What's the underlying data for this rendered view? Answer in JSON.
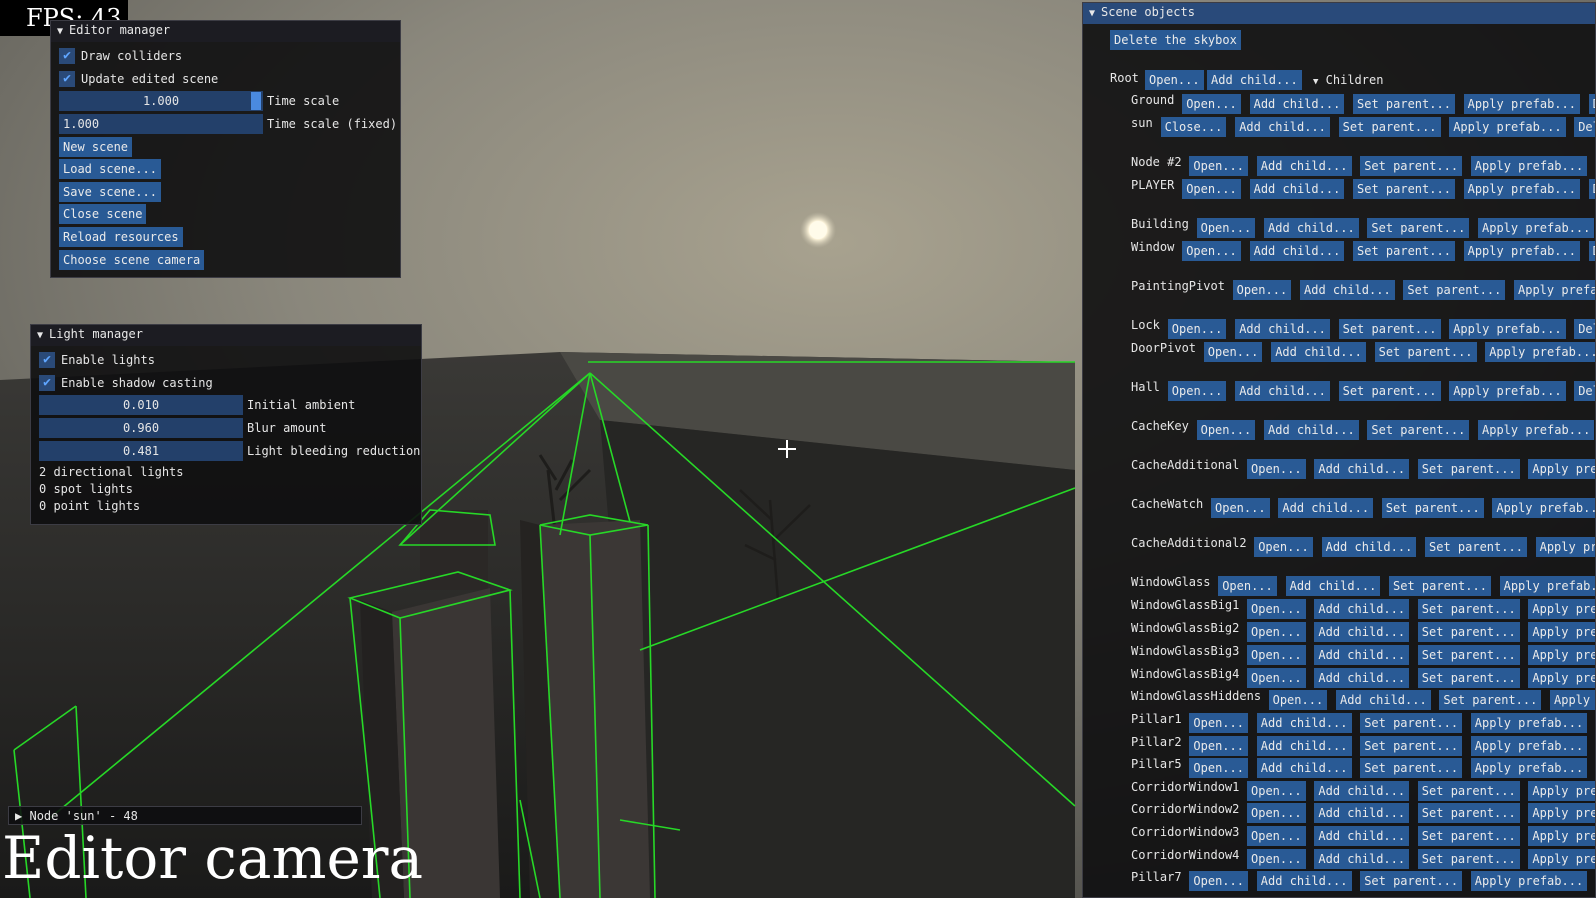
{
  "fps": "FPS: 43",
  "editor_manager": {
    "title": "Editor manager",
    "draw_colliders": "Draw colliders",
    "update_edited_scene": "Update edited scene",
    "time_scale_value": "1.000",
    "time_scale_label": "Time scale",
    "time_scale_fixed_value": "1.000",
    "time_scale_fixed_label": "Time scale (fixed)",
    "buttons": [
      "New scene",
      "Load scene...",
      "Save scene...",
      "Close scene",
      "Reload resources",
      "Choose scene camera"
    ]
  },
  "light_manager": {
    "title": "Light manager",
    "enable_lights": "Enable lights",
    "enable_shadow_casting": "Enable shadow casting",
    "initial_ambient_value": "0.010",
    "initial_ambient_label": "Initial ambient",
    "blur_amount_value": "0.960",
    "blur_amount_label": "Blur amount",
    "light_bleeding_value": "0.481",
    "light_bleeding_label": "Light bleeding reduction",
    "directional": "2 directional lights",
    "spot": "0 spot lights",
    "point": "0 point lights"
  },
  "status": "Node 'sun' - 48",
  "caption": "Editor camera",
  "scene_objects": {
    "title": "Scene objects",
    "delete_skybox": "Delete the skybox",
    "root_label": "Root",
    "root_open": "Open...",
    "root_add_child": "Add child...",
    "children_label": "Children",
    "nodes": [
      {
        "name": "Ground",
        "first": "Open..."
      },
      {
        "name": "sun",
        "first": "Close..."
      },
      {
        "name": "Node #2",
        "first": "Open..."
      },
      {
        "name": "PLAYER",
        "first": "Open..."
      },
      {
        "name": "Building",
        "first": "Open..."
      },
      {
        "name": "Window",
        "first": "Open..."
      },
      {
        "name": "PaintingPivot",
        "first": "Open..."
      },
      {
        "name": "Lock",
        "first": "Open..."
      },
      {
        "name": "DoorPivot",
        "first": "Open..."
      },
      {
        "name": "Hall",
        "first": "Open..."
      },
      {
        "name": "CacheKey",
        "first": "Open..."
      },
      {
        "name": "CacheAdditional",
        "first": "Open..."
      },
      {
        "name": "CacheWatch",
        "first": "Open..."
      },
      {
        "name": "CacheAdditional2",
        "first": "Open..."
      },
      {
        "name": "WindowGlass",
        "first": "Open..."
      },
      {
        "name": "WindowGlassBig1",
        "first": "Open..."
      },
      {
        "name": "WindowGlassBig2",
        "first": "Open..."
      },
      {
        "name": "WindowGlassBig3",
        "first": "Open..."
      },
      {
        "name": "WindowGlassBig4",
        "first": "Open..."
      },
      {
        "name": "WindowGlassHiddens",
        "first": "Open..."
      },
      {
        "name": "Pillar1",
        "first": "Open..."
      },
      {
        "name": "Pillar2",
        "first": "Open..."
      },
      {
        "name": "Pillar5",
        "first": "Open..."
      },
      {
        "name": "CorridorWindow1",
        "first": "Open..."
      },
      {
        "name": "CorridorWindow2",
        "first": "Open..."
      },
      {
        "name": "CorridorWindow3",
        "first": "Open..."
      },
      {
        "name": "CorridorWindow4",
        "first": "Open..."
      },
      {
        "name": "Pillar7",
        "first": "Open..."
      }
    ],
    "add_child": "Add child...",
    "set_parent": "Set parent...",
    "apply_prefab": "Apply prefab...",
    "delete": "Delete"
  },
  "colors": {
    "wireframe": "#27d827",
    "button": "#295a95",
    "panel_header_active": "#294a7a"
  }
}
